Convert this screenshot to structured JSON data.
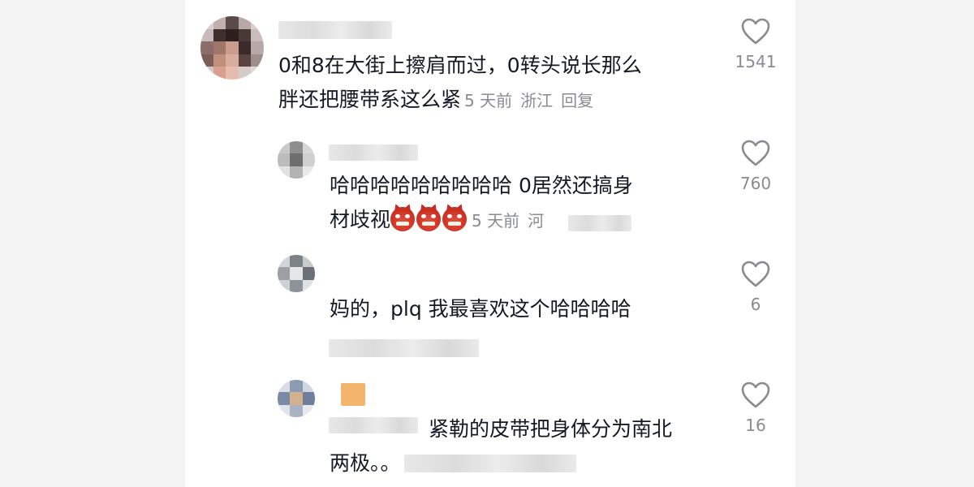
{
  "comments": [
    {
      "text_line1": "0和8在大街上擦肩而过，0转头说长那么",
      "text_line2": "胖还把腰带系这么紧",
      "time": "5 天前",
      "location": "浙江",
      "reply_label": "回复",
      "likes": "1541"
    },
    {
      "text_line1": "哈哈哈哈哈哈哈哈哈 0居然还搞身",
      "text_line2": "材歧视",
      "emoji": [
        "angry-devil-emoji",
        "angry-devil-emoji",
        "angry-devil-emoji"
      ],
      "time": "5 天前",
      "location_partial": "河",
      "likes": "760"
    },
    {
      "text": "妈的，plq 我最喜欢这个哈哈哈哈",
      "likes": "6"
    },
    {
      "text_line1": "紧勒的皮带把身体分为南北",
      "text_line2": "两极。。",
      "likes": "16"
    }
  ],
  "icons": {
    "like": "heart-outline-icon"
  },
  "colors": {
    "text": "#161823",
    "meta": "#8a8b91",
    "background": "#ffffff"
  }
}
